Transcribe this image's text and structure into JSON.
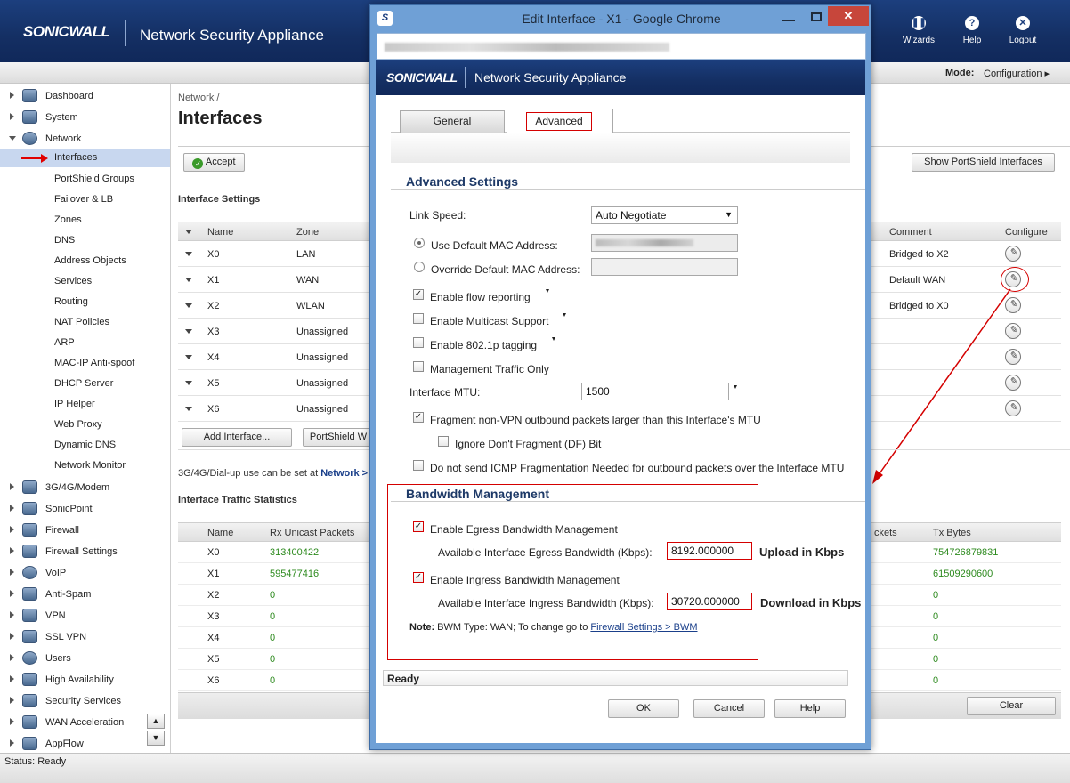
{
  "header": {
    "logo": "SONICWALL",
    "product": "Network Security Appliance",
    "buttons": [
      {
        "label": "Wizards",
        "icon": "wizard-icon"
      },
      {
        "label": "Help",
        "icon": "help-icon"
      },
      {
        "label": "Logout",
        "icon": "logout-icon"
      }
    ]
  },
  "modebar": {
    "mode_label": "Mode:",
    "mode_value": "Configuration ▸"
  },
  "nav": {
    "dashboard": "Dashboard",
    "system": "System",
    "network": "Network",
    "network_sub": [
      "Interfaces",
      "PortShield Groups",
      "Failover & LB",
      "Zones",
      "DNS",
      "Address Objects",
      "Services",
      "Routing",
      "NAT Policies",
      "ARP",
      "MAC-IP Anti-spoof",
      "DHCP Server",
      "IP Helper",
      "Web Proxy",
      "Dynamic DNS",
      "Network Monitor"
    ],
    "rest": [
      "3G/4G/Modem",
      "SonicPoint",
      "Firewall",
      "Firewall Settings",
      "VoIP",
      "Anti-Spam",
      "VPN",
      "SSL VPN",
      "Users",
      "High Availability",
      "Security Services",
      "WAN Acceleration",
      "AppFlow"
    ]
  },
  "main": {
    "breadcrumb": "Network /",
    "title": "Interfaces",
    "accept": "Accept",
    "show_portshield": "Show PortShield Interfaces",
    "interface_settings": "Interface Settings",
    "columns": {
      "name": "Name",
      "zone": "Zone",
      "comment": "Comment",
      "configure": "Configure"
    },
    "interfaces": [
      {
        "name": "X0",
        "zone": "LAN",
        "comment": "Bridged to X2"
      },
      {
        "name": "X1",
        "zone": "WAN",
        "comment": "Default WAN"
      },
      {
        "name": "X2",
        "zone": "WLAN",
        "comment": "Bridged to X0"
      },
      {
        "name": "X3",
        "zone": "Unassigned",
        "comment": ""
      },
      {
        "name": "X4",
        "zone": "Unassigned",
        "comment": ""
      },
      {
        "name": "X5",
        "zone": "Unassigned",
        "comment": ""
      },
      {
        "name": "X6",
        "zone": "Unassigned",
        "comment": ""
      }
    ],
    "add_interface": "Add Interface...",
    "portshield_wizard": "PortShield W",
    "dialup_note": "3G/4G/Dial-up use can be set at",
    "dialup_link": "Network >",
    "traffic_stats": "Interface Traffic Statistics",
    "stat_columns": {
      "name": "Name",
      "rx": "Rx Unicast Packets",
      "kets": "ckets",
      "tx": "Tx Bytes"
    },
    "stats": [
      {
        "name": "X0",
        "rx": "313400422",
        "tx": "7547268798​31"
      },
      {
        "name": "X1",
        "rx": "595477416",
        "tx": "61509290600"
      },
      {
        "name": "X2",
        "rx": "0",
        "tx": "0"
      },
      {
        "name": "X3",
        "rx": "0",
        "tx": "0"
      },
      {
        "name": "X4",
        "rx": "0",
        "tx": "0"
      },
      {
        "name": "X5",
        "rx": "0",
        "tx": "0"
      },
      {
        "name": "X6",
        "rx": "0",
        "tx": "0"
      }
    ],
    "clear": "Clear"
  },
  "status": "Status: Ready",
  "dialog": {
    "title": "Edit Interface - X1 - Google Chrome",
    "logo": "SONICWALL",
    "product": "Network Security Appliance",
    "tabs": [
      "General",
      "Advanced"
    ],
    "section": "Advanced Settings",
    "link_speed_label": "Link Speed:",
    "link_speed_value": "Auto Negotiate",
    "use_default_mac": "Use Default MAC Address:",
    "override_mac": "Override Default MAC Address:",
    "flow_reporting": "Enable flow reporting",
    "multicast": "Enable Multicast Support",
    "tagging": "Enable 802.1p tagging",
    "mgmt_only": "Management Traffic Only",
    "mtu_label": "Interface MTU:",
    "mtu_value": "1500",
    "fragment": "Fragment non-VPN outbound packets larger than this Interface's MTU",
    "ignore_df": "Ignore Don't Fragment (DF) Bit",
    "no_icmp": "Do not send ICMP Fragmentation Needed for outbound packets over the Interface MTU",
    "bw_section": "Bandwidth Management",
    "egress_enable": "Enable Egress Bandwidth Management",
    "egress_label": "Available Interface Egress Bandwidth (Kbps):",
    "egress_value": "8192.000000",
    "upload_note": "Upload in Kbps",
    "ingress_enable": "Enable Ingress Bandwidth Management",
    "ingress_label": "Available Interface Ingress Bandwidth (Kbps):",
    "ingress_value": "30720.000000",
    "download_note": "Download in Kbps",
    "note_bold": "Note:",
    "note_text": "BWM Type: WAN; To change go to",
    "note_link": "Firewall Settings > BWM",
    "ready": "Ready",
    "ok": "OK",
    "cancel": "Cancel",
    "help": "Help"
  }
}
